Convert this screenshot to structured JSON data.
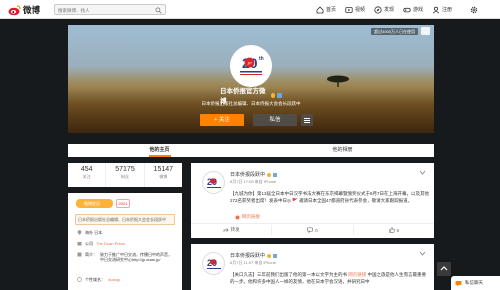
{
  "nav": {
    "logo_text": "微博",
    "search_placeholder": "搜索微博、找人",
    "links": [
      {
        "label": "首页",
        "icon": "home-icon"
      },
      {
        "label": "视频",
        "icon": "video-icon"
      },
      {
        "label": "发现",
        "icon": "discover-icon"
      },
      {
        "label": "游戏",
        "icon": "game-icon"
      },
      {
        "label": "注册",
        "icon": "user-icon"
      }
    ]
  },
  "cover": {
    "badge": "超过4000万人已在使用",
    "name": "日本侨报官方微博",
    "description": "日本侨报出版社总编辑、日本侨报大会会长段跃中",
    "follow_label": "+ 关注",
    "message_label": "私信"
  },
  "tabs": [
    "他的主页",
    "他的相册"
  ],
  "stats": [
    {
      "value": "454",
      "label": "关注"
    },
    {
      "value": "57175",
      "label": "粉丝"
    },
    {
      "value": "15147",
      "label": "微博"
    }
  ],
  "profile_card": {
    "v_tag": "微博会员",
    "vip_tag": "2021",
    "intro": "日本侨报出版社总编辑、日本侨报大会会长段跃中",
    "location": "海外 日本",
    "company_label": "公司",
    "company": "The Duan Press",
    "bio_label": "简介：",
    "bio": "致力于推广中日交流，传播日中的声音，中日交流研究中心http://jp.duan.jp/",
    "domain_label": "个性域名：",
    "domain": "duanjp"
  },
  "feed": [
    {
      "author": "日本侨报段跃中",
      "meta": "8月7日 17:05 来自 iPhone",
      "text": "【九城为你】第13届全日本中日汉字书法大赛在东京揭幕暨颁奖仪式于8月7日在上海开幕，以及其他272名获奖者出席！发表中日◎ 🚩",
      "text2": "邀请日本全国47都道府县代表参会，敬请大家跟踪报道。",
      "link": "网页链接",
      "forward": "转发",
      "comment": "0",
      "like": "6"
    },
    {
      "author": "日本侨报段跃中",
      "meta": "8月7日 11:07 来自 iPhone",
      "text": "【关口久志】三年前我们出版了他的第一本以文字为主的书",
      "link": "网页链接",
      "text2": "中国之旅是他人生而言最重要的一步。他和许多中国人一样的友情，他在日本学会汉语，并研究日中"
    }
  ],
  "chat_label": "私信聊天"
}
